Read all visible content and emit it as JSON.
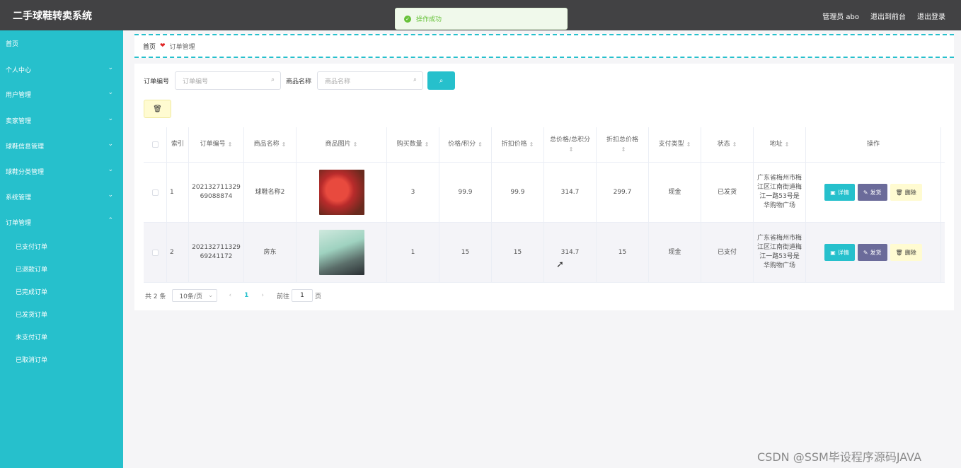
{
  "app": {
    "title": "二手球鞋转卖系统"
  },
  "toast": {
    "text": "操作成功",
    "icon": "check-circle-icon"
  },
  "header": {
    "admin": "管理员 abo",
    "front": "退出到前台",
    "logout": "退出登录"
  },
  "sidebar": {
    "items": [
      {
        "label": "首页"
      },
      {
        "label": "个人中心"
      },
      {
        "label": "用户管理"
      },
      {
        "label": "卖家管理"
      },
      {
        "label": "球鞋信息管理"
      },
      {
        "label": "球鞋分类管理"
      },
      {
        "label": "系统管理"
      },
      {
        "label": "订单管理"
      }
    ],
    "sub_items": [
      {
        "label": "已支付订单"
      },
      {
        "label": "已退款订单"
      },
      {
        "label": "已完成订单"
      },
      {
        "label": "已发货订单"
      },
      {
        "label": "未支付订单"
      },
      {
        "label": "已取消订单"
      }
    ]
  },
  "breadcrumb": {
    "home": "首页",
    "separator": "❤",
    "current": "订单管理"
  },
  "search": {
    "order_label": "订单编号",
    "order_placeholder": "订单编号",
    "goods_label": "商品名称",
    "goods_placeholder": "商品名称"
  },
  "table": {
    "headers": [
      "索引",
      "订单编号",
      "商品名称",
      "商品图片",
      "购买数量",
      "价格/积分",
      "折扣价格",
      "总价格/总积分",
      "折扣总价格",
      "支付类型",
      "状态",
      "地址",
      "操作"
    ],
    "rows": [
      {
        "index": "1",
        "order_no": "20213271132969088874",
        "goods": "球鞋名称2",
        "image": "shoe",
        "qty": "3",
        "price": "99.9",
        "discount": "99.9",
        "total": "314.7",
        "discount_total": "299.7",
        "pay": "现金",
        "status": "已发货",
        "address": "广东省梅州市梅江区江南街道梅江一路53号是华购物广场"
      },
      {
        "index": "2",
        "order_no": "20213271132969241172",
        "goods": "房东",
        "image": "person",
        "qty": "1",
        "price": "15",
        "discount": "15",
        "total": "314.7",
        "discount_total": "15",
        "pay": "现金",
        "status": "已支付",
        "address": "广东省梅州市梅江区江南街道梅江一路53号是华购物广场"
      }
    ],
    "actions": {
      "detail": "详情",
      "ship": "发货",
      "delete": "删除"
    }
  },
  "pagination": {
    "total": "共 2 条",
    "page_size": "10条/页",
    "current": "1",
    "goto_label": "前往",
    "goto_value": "1",
    "page_unit": "页"
  },
  "watermark": "CSDN @SSM毕设程序源码JAVA",
  "colors": {
    "accent": "#26c0cc",
    "header": "#424244",
    "ship_button": "#6b6b9a",
    "delete_button": "#fffbd1",
    "success": "#67c23a"
  }
}
